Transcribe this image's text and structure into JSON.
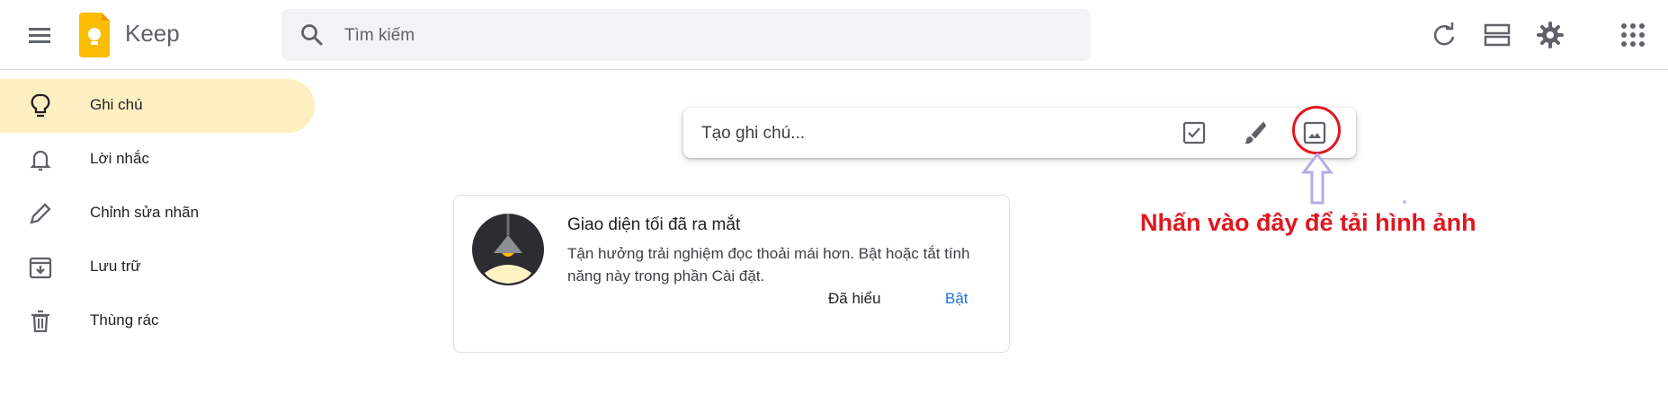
{
  "header": {
    "app_title": "Keep",
    "search_placeholder": "Tìm kiếm"
  },
  "sidebar": {
    "items": [
      {
        "label": "Ghi chú",
        "icon": "lightbulb-icon",
        "active": true
      },
      {
        "label": "Lời nhắc",
        "icon": "bell-icon",
        "active": false
      },
      {
        "label": "Chỉnh sửa nhãn",
        "icon": "pencil-icon",
        "active": false
      },
      {
        "label": "Lưu trữ",
        "icon": "archive-icon",
        "active": false
      },
      {
        "label": "Thùng rác",
        "icon": "trash-icon",
        "active": false
      }
    ]
  },
  "note_input": {
    "placeholder": "Tạo ghi chú..."
  },
  "annotation": {
    "text": "Nhấn vào đây để tải hình ảnh",
    "color": "#e0171f"
  },
  "card": {
    "title": "Giao diện tối đã ra mắt",
    "body": "Tận hưởng trải nghiệm đọc thoải mái hơn. Bật hoặc tắt tính năng này trong phần Cài đặt.",
    "dismiss_label": "Đã hiểu",
    "enable_label": "Bật"
  },
  "colors": {
    "accent": "#1a73e8",
    "active_nav": "#feefc3",
    "logo": "#fbbc04"
  }
}
